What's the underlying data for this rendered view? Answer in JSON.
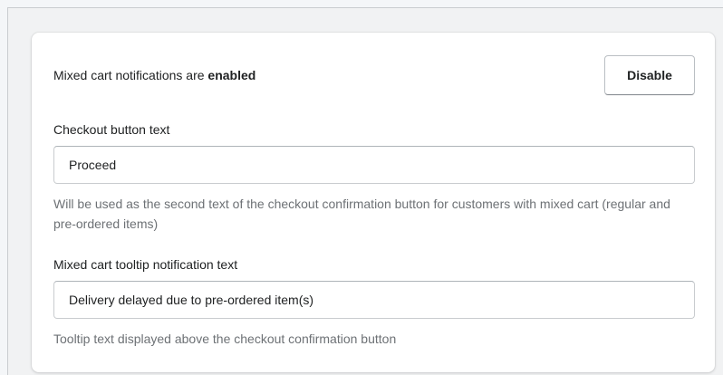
{
  "status": {
    "prefix": "Mixed cart notifications are ",
    "state": "enabled",
    "disable_label": "Disable"
  },
  "checkout_field": {
    "label": "Checkout button text",
    "value": "Proceed",
    "help": "Will be used as the second text of the checkout confirmation button for customers with mixed cart (regular and pre-ordered items)"
  },
  "tooltip_field": {
    "label": "Mixed cart tooltip notification text",
    "value": "Delivery delayed due to pre-ordered item(s)",
    "help": "Tooltip text displayed above the checkout confirmation button"
  }
}
